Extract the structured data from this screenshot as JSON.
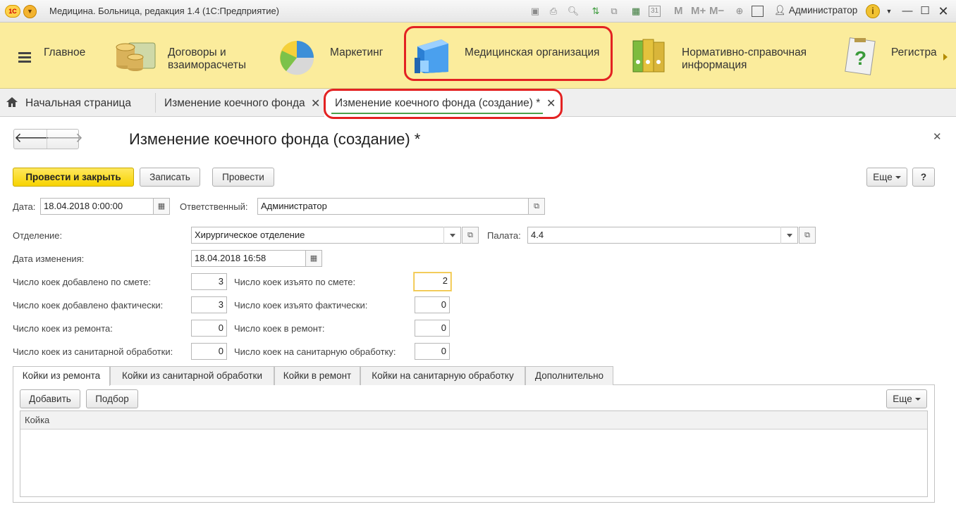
{
  "window": {
    "title": "Медицина. Больница, редакция 1.4  (1С:Предприятие)",
    "logo_text": "1С",
    "user": "Администратор",
    "memory_buttons": [
      "M",
      "M+",
      "M−"
    ]
  },
  "sections": [
    {
      "label": "Главное"
    },
    {
      "label": "Договоры и взаиморасчеты"
    },
    {
      "label": "Маркетинг"
    },
    {
      "label": "Медицинская организация"
    },
    {
      "label": "Нормативно-справочная информация"
    },
    {
      "label": "Регистра"
    }
  ],
  "tabs": {
    "home": "Начальная страница",
    "items": [
      {
        "label": "Изменение коечного фонда"
      },
      {
        "label": "Изменение коечного фонда (создание) *"
      }
    ]
  },
  "form": {
    "title": "Изменение коечного фонда (создание) *",
    "buttons": {
      "post_close": "Провести и закрыть",
      "save": "Записать",
      "post": "Провести",
      "more": "Еще",
      "help": "?"
    },
    "date_label": "Дата:",
    "date_value": "18.04.2018  0:00:00",
    "responsible_label": "Ответственный:",
    "responsible_value": "Администратор",
    "department_label": "Отделение:",
    "department_value": "Хирургическое отделение",
    "ward_label": "Палата:",
    "ward_value": "4.4",
    "change_date_label": "Дата изменения:",
    "change_date_value": "18.04.2018 16:58",
    "counts": {
      "added_by_estimate_label": "Число коек добавлено по смете:",
      "added_by_estimate": "3",
      "removed_by_estimate_label": "Число коек изъято по смете:",
      "removed_by_estimate": "2",
      "added_actual_label": "Число коек добавлено фактически:",
      "added_actual": "3",
      "removed_actual_label": "Число коек изъято фактически:",
      "removed_actual": "0",
      "from_repair_label": "Число коек из ремонта:",
      "from_repair": "0",
      "to_repair_label": "Число коек в ремонт:",
      "to_repair": "0",
      "from_sanitary_label": "Число коек из санитарной обработки:",
      "from_sanitary": "0",
      "to_sanitary_label": "Число коек на санитарную обработку:",
      "to_sanitary": "0"
    }
  },
  "bottom_tabs": [
    {
      "label": "Койки из ремонта"
    },
    {
      "label": "Койки из санитарной обработки"
    },
    {
      "label": "Койки в ремонт"
    },
    {
      "label": "Койки на санитарную обработку"
    },
    {
      "label": "Дополнительно"
    }
  ],
  "table": {
    "add": "Добавить",
    "pick": "Подбор",
    "more": "Еще",
    "column": "Койка"
  },
  "colors": {
    "sections_bg": "#fbec9c",
    "primary_button": "#f7d300",
    "highlight": "#e32222",
    "active_tab_underline": "#4aa14a"
  }
}
